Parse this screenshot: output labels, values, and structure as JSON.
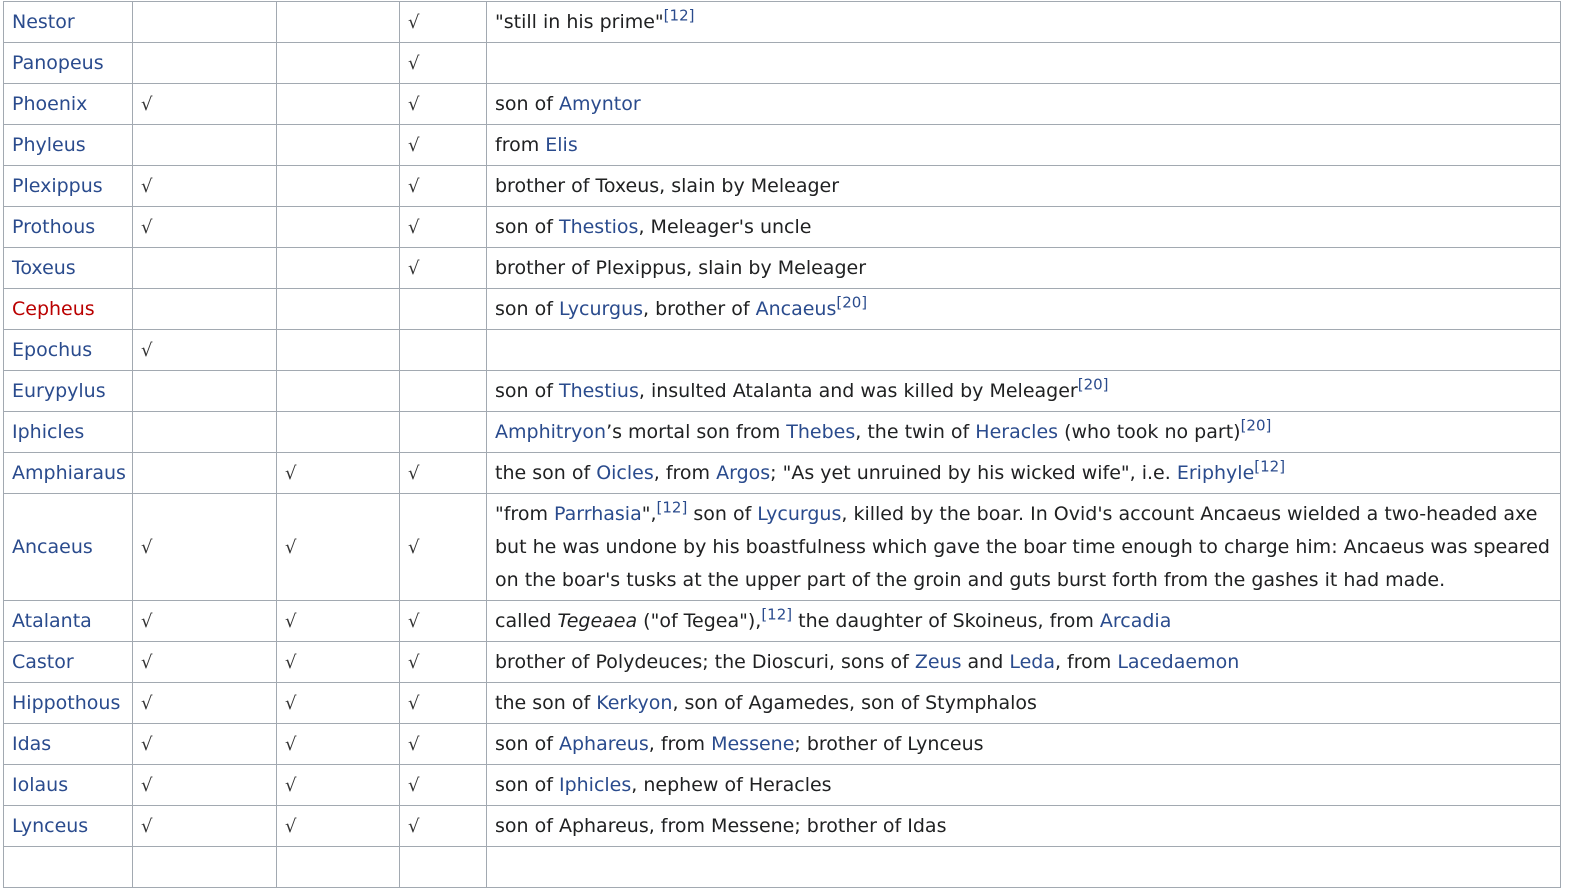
{
  "table": {
    "rows": [
      {
        "name": "Nestor",
        "name_red": false,
        "a": "",
        "b": "",
        "c": "√",
        "desc": [
          {
            "t": "text",
            "v": "\"still in his prime\""
          },
          {
            "t": "ref",
            "v": "[12]"
          }
        ]
      },
      {
        "name": "Panopeus",
        "name_red": false,
        "a": "",
        "b": "",
        "c": "√",
        "desc": []
      },
      {
        "name": "Phoenix",
        "name_red": false,
        "a": "√",
        "b": "",
        "c": "√",
        "desc": [
          {
            "t": "text",
            "v": "son of "
          },
          {
            "t": "link",
            "v": "Amyntor"
          }
        ]
      },
      {
        "name": "Phyleus",
        "name_red": false,
        "a": "",
        "b": "",
        "c": "√",
        "desc": [
          {
            "t": "text",
            "v": "from "
          },
          {
            "t": "link",
            "v": "Elis"
          }
        ]
      },
      {
        "name": "Plexippus",
        "name_red": false,
        "a": "√",
        "b": "",
        "c": "√",
        "desc": [
          {
            "t": "text",
            "v": "brother of Toxeus, slain by Meleager"
          }
        ]
      },
      {
        "name": "Prothous",
        "name_red": false,
        "a": "√",
        "b": "",
        "c": "√",
        "desc": [
          {
            "t": "text",
            "v": "son of "
          },
          {
            "t": "link",
            "v": "Thestios"
          },
          {
            "t": "text",
            "v": ", Meleager's uncle"
          }
        ]
      },
      {
        "name": "Toxeus",
        "name_red": false,
        "a": "",
        "b": "",
        "c": "√",
        "desc": [
          {
            "t": "text",
            "v": "brother of Plexippus, slain by Meleager"
          }
        ]
      },
      {
        "name": "Cepheus",
        "name_red": true,
        "a": "",
        "b": "",
        "c": "",
        "desc": [
          {
            "t": "text",
            "v": "son of "
          },
          {
            "t": "link",
            "v": "Lycurgus"
          },
          {
            "t": "text",
            "v": ", brother of "
          },
          {
            "t": "link",
            "v": "Ancaeus"
          },
          {
            "t": "ref",
            "v": "[20]"
          }
        ]
      },
      {
        "name": "Epochus",
        "name_red": false,
        "a": "√",
        "b": "",
        "c": "",
        "desc": []
      },
      {
        "name": "Eurypylus",
        "name_red": false,
        "a": "",
        "b": "",
        "c": "",
        "desc": [
          {
            "t": "text",
            "v": "son of "
          },
          {
            "t": "link",
            "v": "Thestius"
          },
          {
            "t": "text",
            "v": ", insulted Atalanta and was killed by Meleager"
          },
          {
            "t": "ref",
            "v": "[20]"
          }
        ]
      },
      {
        "name": "Iphicles",
        "name_red": false,
        "a": "",
        "b": "",
        "c": "",
        "desc": [
          {
            "t": "link",
            "v": "Amphitryon"
          },
          {
            "t": "text",
            "v": "’s mortal son from "
          },
          {
            "t": "link",
            "v": "Thebes"
          },
          {
            "t": "text",
            "v": ", the twin of "
          },
          {
            "t": "link",
            "v": "Heracles"
          },
          {
            "t": "text",
            "v": " (who took no part)"
          },
          {
            "t": "ref",
            "v": "[20]"
          }
        ]
      },
      {
        "name": "Amphiaraus",
        "name_red": false,
        "a": "",
        "b": "√",
        "c": "√",
        "desc": [
          {
            "t": "text",
            "v": "the son of "
          },
          {
            "t": "link",
            "v": "Oicles"
          },
          {
            "t": "text",
            "v": ", from "
          },
          {
            "t": "link",
            "v": "Argos"
          },
          {
            "t": "text",
            "v": "; \"As yet unruined by his wicked wife\", i.e. "
          },
          {
            "t": "link",
            "v": "Eriphyle"
          },
          {
            "t": "ref",
            "v": "[12]"
          }
        ]
      },
      {
        "name": "Ancaeus",
        "name_red": false,
        "a": "√",
        "b": "√",
        "c": "√",
        "tall": true,
        "desc": [
          {
            "t": "text",
            "v": "\"from "
          },
          {
            "t": "link",
            "v": "Parrhasia"
          },
          {
            "t": "text",
            "v": "\","
          },
          {
            "t": "ref",
            "v": "[12]"
          },
          {
            "t": "text",
            "v": " son of "
          },
          {
            "t": "link",
            "v": "Lycurgus"
          },
          {
            "t": "text",
            "v": ", killed by the boar. In Ovid's account Ancaeus wielded a two-headed axe but he was undone by his boastfulness which gave the boar time enough to charge him: Ancaeus was speared on the boar's tusks at the upper part of the groin and guts burst forth from the gashes it had made."
          }
        ]
      },
      {
        "name": "Atalanta",
        "name_red": false,
        "a": "√",
        "b": "√",
        "c": "√",
        "desc": [
          {
            "t": "text",
            "v": "called "
          },
          {
            "t": "italic",
            "v": "Tegeaea"
          },
          {
            "t": "text",
            "v": " (\"of Tegea\"),"
          },
          {
            "t": "ref",
            "v": "[12]"
          },
          {
            "t": "text",
            "v": " the daughter of Skoineus, from "
          },
          {
            "t": "link",
            "v": "Arcadia"
          }
        ]
      },
      {
        "name": "Castor",
        "name_red": false,
        "a": "√",
        "b": "√",
        "c": "√",
        "desc": [
          {
            "t": "text",
            "v": "brother of Polydeuces; the Dioscuri, sons of "
          },
          {
            "t": "link",
            "v": "Zeus"
          },
          {
            "t": "text",
            "v": " and "
          },
          {
            "t": "link",
            "v": "Leda"
          },
          {
            "t": "text",
            "v": ", from "
          },
          {
            "t": "link",
            "v": "Lacedaemon"
          }
        ]
      },
      {
        "name": "Hippothous",
        "name_red": false,
        "a": "√",
        "b": "√",
        "c": "√",
        "desc": [
          {
            "t": "text",
            "v": "the son of "
          },
          {
            "t": "link",
            "v": "Kerkyon"
          },
          {
            "t": "text",
            "v": ", son of Agamedes, son of Stymphalos"
          }
        ]
      },
      {
        "name": "Idas",
        "name_red": false,
        "a": "√",
        "b": "√",
        "c": "√",
        "desc": [
          {
            "t": "text",
            "v": "son of "
          },
          {
            "t": "link",
            "v": "Aphareus"
          },
          {
            "t": "text",
            "v": ", from "
          },
          {
            "t": "link",
            "v": "Messene"
          },
          {
            "t": "text",
            "v": "; brother of Lynceus"
          }
        ]
      },
      {
        "name": "Iolaus",
        "name_red": false,
        "a": "√",
        "b": "√",
        "c": "√",
        "desc": [
          {
            "t": "text",
            "v": "son of "
          },
          {
            "t": "link",
            "v": "Iphicles"
          },
          {
            "t": "text",
            "v": ", nephew of Heracles"
          }
        ]
      },
      {
        "name": "Lynceus",
        "name_red": false,
        "a": "√",
        "b": "√",
        "c": "√",
        "desc": [
          {
            "t": "text",
            "v": "son of Aphareus, from Messene; brother of Idas"
          }
        ]
      },
      {
        "name": "",
        "name_red": false,
        "a": "",
        "b": "",
        "c": "",
        "desc": []
      }
    ]
  }
}
